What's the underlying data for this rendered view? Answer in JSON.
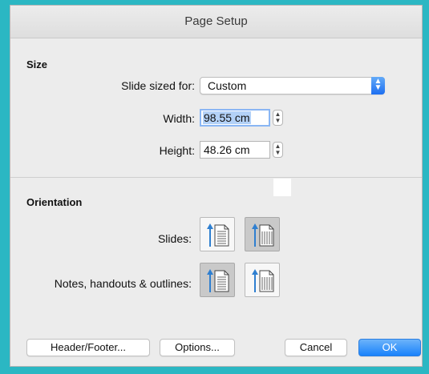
{
  "window": {
    "title": "Page Setup"
  },
  "size": {
    "section_label": "Size",
    "slide_sized_for_label": "Slide sized for:",
    "slide_sized_for_value": "Custom",
    "width_label": "Width:",
    "width_value": "98.55 cm",
    "height_label": "Height:",
    "height_value": "48.26 cm"
  },
  "orientation": {
    "section_label": "Orientation",
    "slides_label": "Slides:",
    "slides_selected": "landscape",
    "notes_label": "Notes, handouts & outlines:",
    "notes_selected": "portrait"
  },
  "buttons": {
    "header_footer": "Header/Footer...",
    "options": "Options...",
    "cancel": "Cancel",
    "ok": "OK"
  },
  "colors": {
    "accent": "#1a82fb",
    "arrow": "#2f7fd0",
    "background": "#2bb7c3"
  },
  "icons": {
    "portrait": "portrait-orientation-icon",
    "landscape": "landscape-orientation-icon",
    "popup": "chevron-up-down-icon",
    "stepper": "stepper-icon"
  }
}
